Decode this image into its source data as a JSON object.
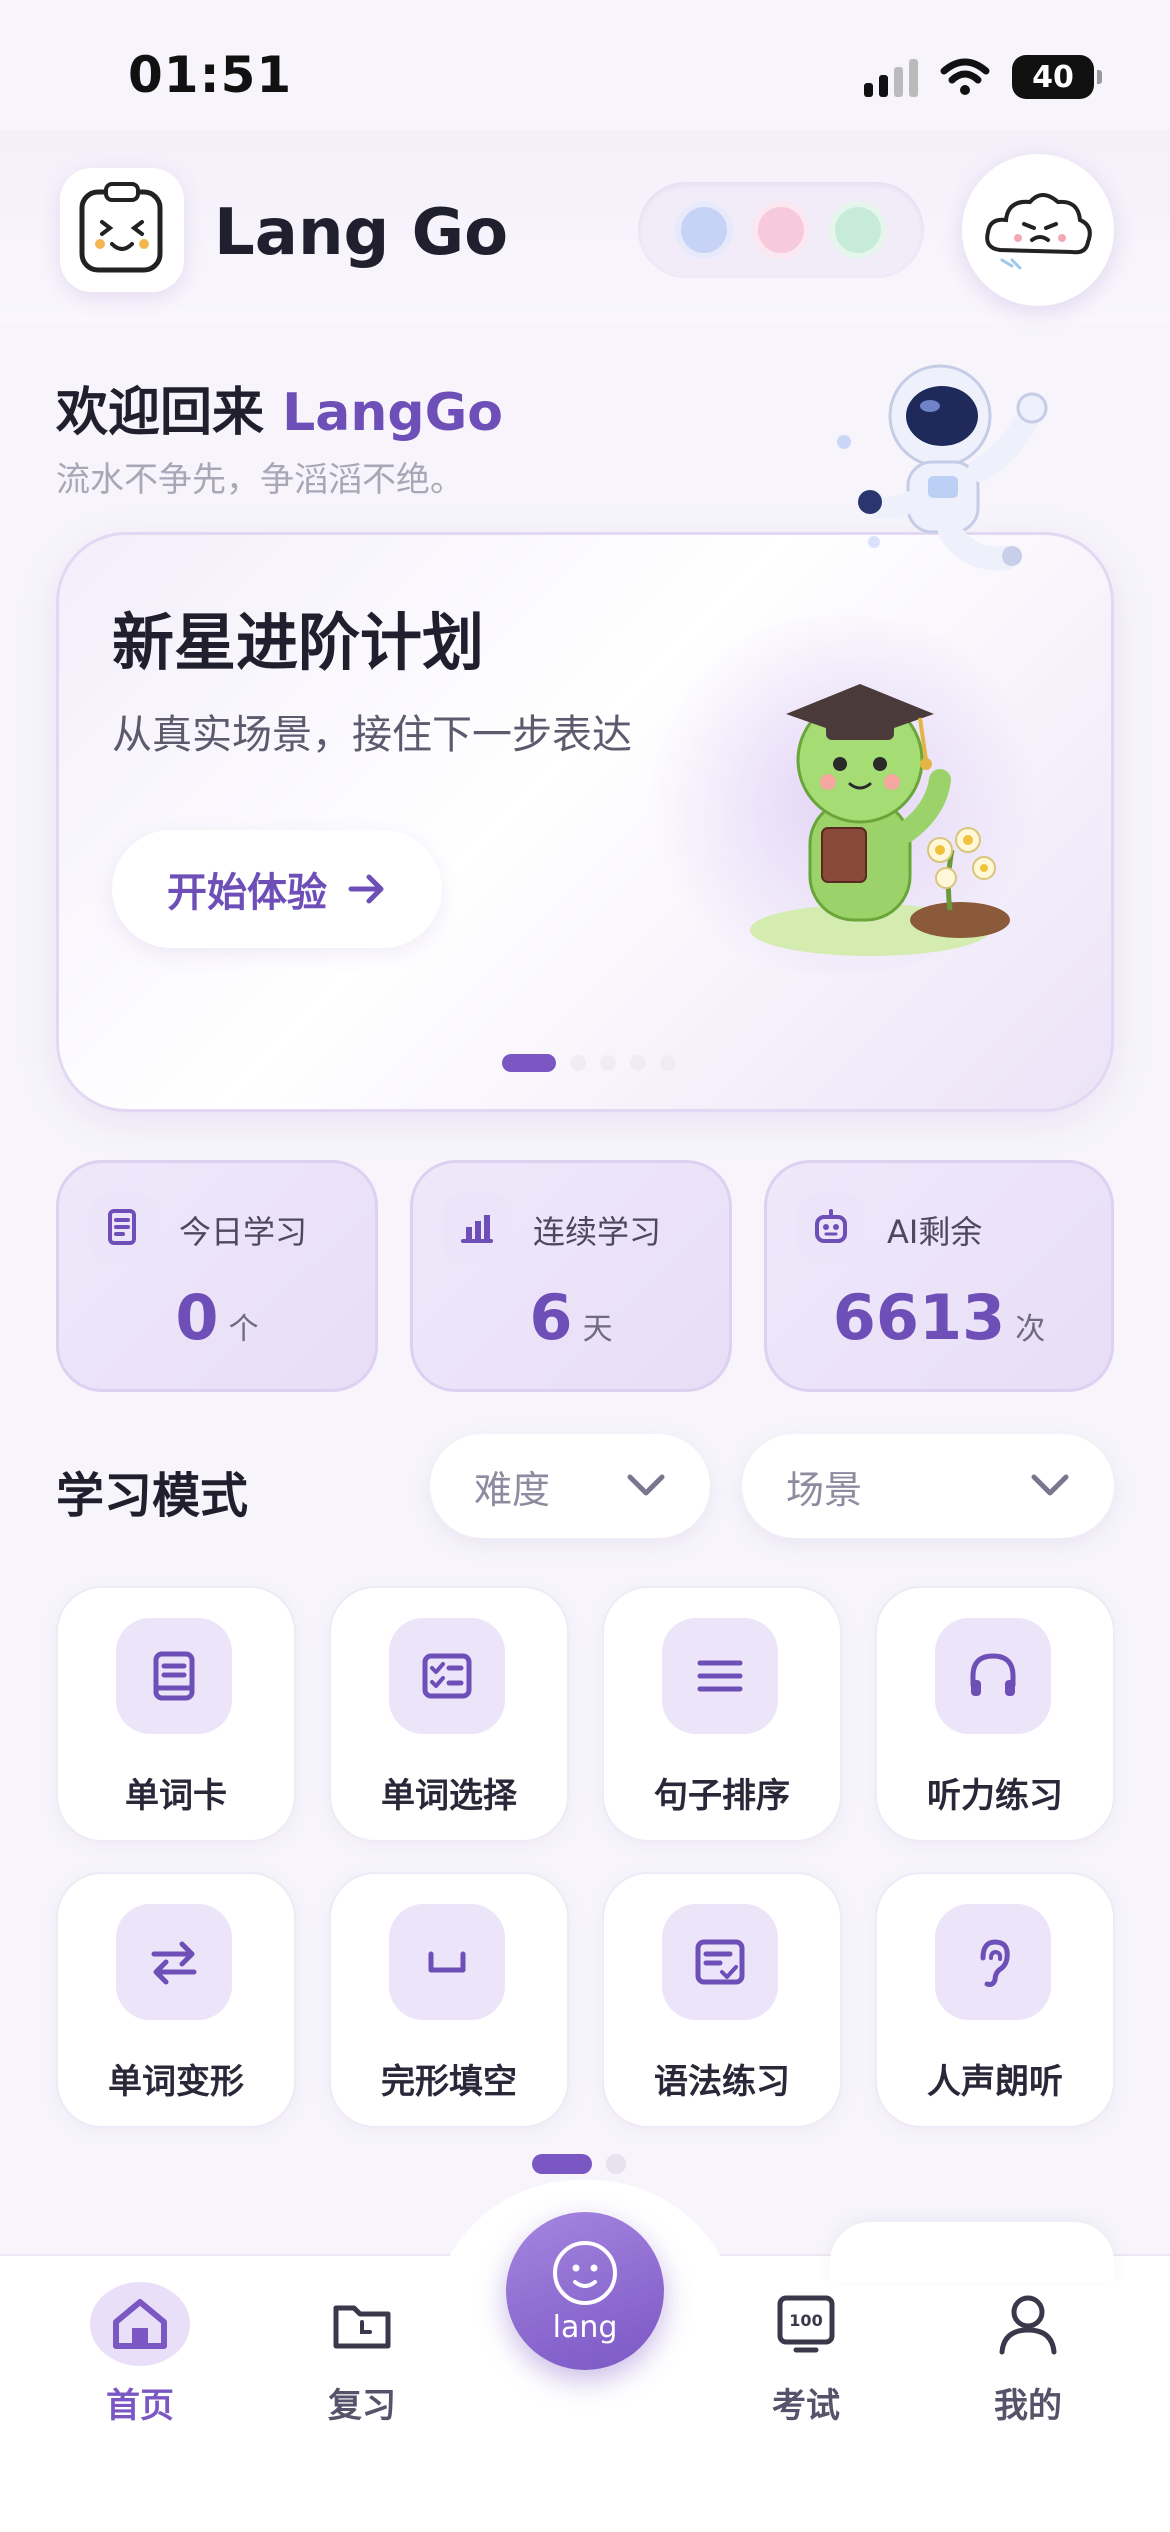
{
  "status_bar": {
    "time": "01:51",
    "battery": "40"
  },
  "header": {
    "title": "Lang Go"
  },
  "theme_dots": [
    "#c7d2f7",
    "#f6c9dc",
    "#c6ecd9"
  ],
  "welcome": {
    "greeting": "欢迎回来 ",
    "name": "LangGo",
    "motto": "流水不争先，争滔滔不绝。"
  },
  "banner": {
    "title": "新星进阶计划",
    "subtitle": "从真实场景，接住下一步表达",
    "cta": "开始体验",
    "pages": 5,
    "active_page": 0
  },
  "stats": [
    {
      "label": "今日学习",
      "value": "0",
      "unit": "个",
      "icon": "document-icon"
    },
    {
      "label": "连续学习",
      "value": "6",
      "unit": "天",
      "icon": "chart-icon"
    },
    {
      "label": "AI剩余",
      "value": "6613",
      "unit": "次",
      "icon": "robot-icon"
    }
  ],
  "learning": {
    "title": "学习模式",
    "difficulty_label": "难度",
    "scene_label": "场景",
    "modes": [
      {
        "label": "单词卡",
        "icon": "book-icon"
      },
      {
        "label": "单词选择",
        "icon": "checklist-icon"
      },
      {
        "label": "句子排序",
        "icon": "lines-icon"
      },
      {
        "label": "听力练习",
        "icon": "headphones-icon"
      },
      {
        "label": "单词变形",
        "icon": "swap-icon"
      },
      {
        "label": "完形填空",
        "icon": "blank-icon"
      },
      {
        "label": "语法练习",
        "icon": "grammar-icon"
      },
      {
        "label": "人声朗听",
        "icon": "ear-icon"
      }
    ]
  },
  "tabbar": {
    "items": [
      {
        "label": "首页",
        "icon": "home-icon",
        "active": true
      },
      {
        "label": "复习",
        "icon": "folder-clock-icon",
        "active": false
      },
      {
        "label": "考试",
        "icon": "exam-100-icon",
        "active": false
      },
      {
        "label": "我的",
        "icon": "user-icon",
        "active": false
      }
    ],
    "center_label": "lang"
  },
  "colors": {
    "accent": "#7b57c4",
    "brand_text": "#6e4fb8"
  }
}
